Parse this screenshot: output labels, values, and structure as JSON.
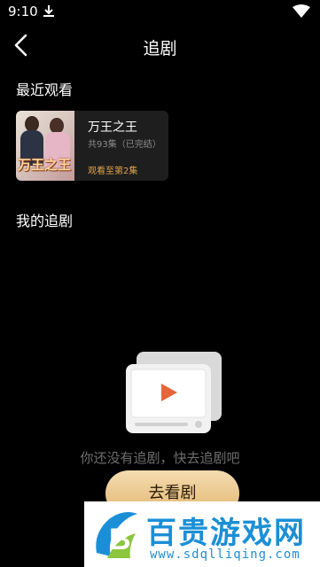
{
  "status_bar": {
    "time": "9:10"
  },
  "header": {
    "title": "追剧"
  },
  "recent": {
    "section_title": "最近观看",
    "card": {
      "cover_text": "万王之王",
      "title": "万王之王",
      "episodes": "共93集（已完结）",
      "progress": "观看至第2集"
    }
  },
  "my_dramas": {
    "section_title": "我的追剧",
    "empty_text": "你还没有追剧，快去追剧吧",
    "button_label": "去看剧"
  },
  "watermark": {
    "brand": "百贵游戏网",
    "url": "www.sdqlliqing.com"
  },
  "colors": {
    "background": "#000000",
    "accent_gold": "#e0a24a",
    "button_gradient_top": "#f4dcb0",
    "button_gradient_bottom": "#e2b670",
    "play_icon": "#e8653a",
    "watermark_blue": "#1b8fd6"
  }
}
